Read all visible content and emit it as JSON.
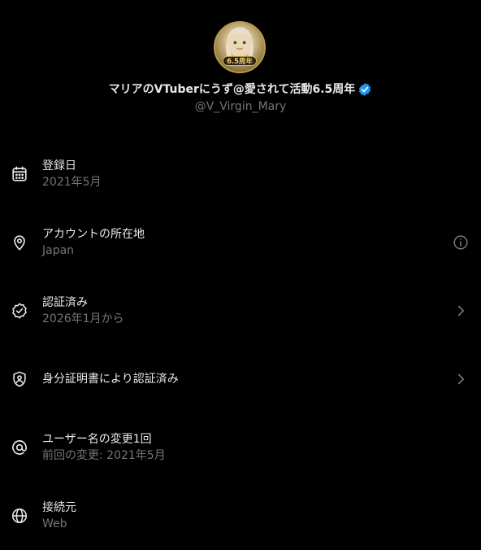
{
  "profile": {
    "display_name": "マリアのVTuberにうず@愛されて活動6.5周年",
    "handle": "@V_Virgin_Mary",
    "avatar_badge_text": "6.5周年",
    "verified_color": "#1d9bf0"
  },
  "rows": [
    {
      "icon": "calendar-icon",
      "title": "登録日",
      "subtitle": "2021年5月",
      "action": null
    },
    {
      "icon": "location-pin-icon",
      "title": "アカウントの所在地",
      "subtitle": "Japan",
      "action": "info-icon"
    },
    {
      "icon": "verified-check-icon",
      "title": "認証済み",
      "subtitle": "2026年1月から",
      "action": "chevron-right-icon"
    },
    {
      "icon": "id-shield-icon",
      "title": "身分証明書により認証済み",
      "subtitle": "",
      "action": "chevron-right-icon"
    },
    {
      "icon": "at-sign-icon",
      "title": "ユーザー名の変更1回",
      "subtitle": "前回の変更: 2021年5月",
      "action": null
    },
    {
      "icon": "globe-icon",
      "title": "接続元",
      "subtitle": "Web",
      "action": null
    }
  ],
  "colors": {
    "background": "#000000",
    "primary_text": "#e7e9ea",
    "secondary_text": "#71767b",
    "icon": "#e7e9ea",
    "action_icon": "#71767b"
  }
}
